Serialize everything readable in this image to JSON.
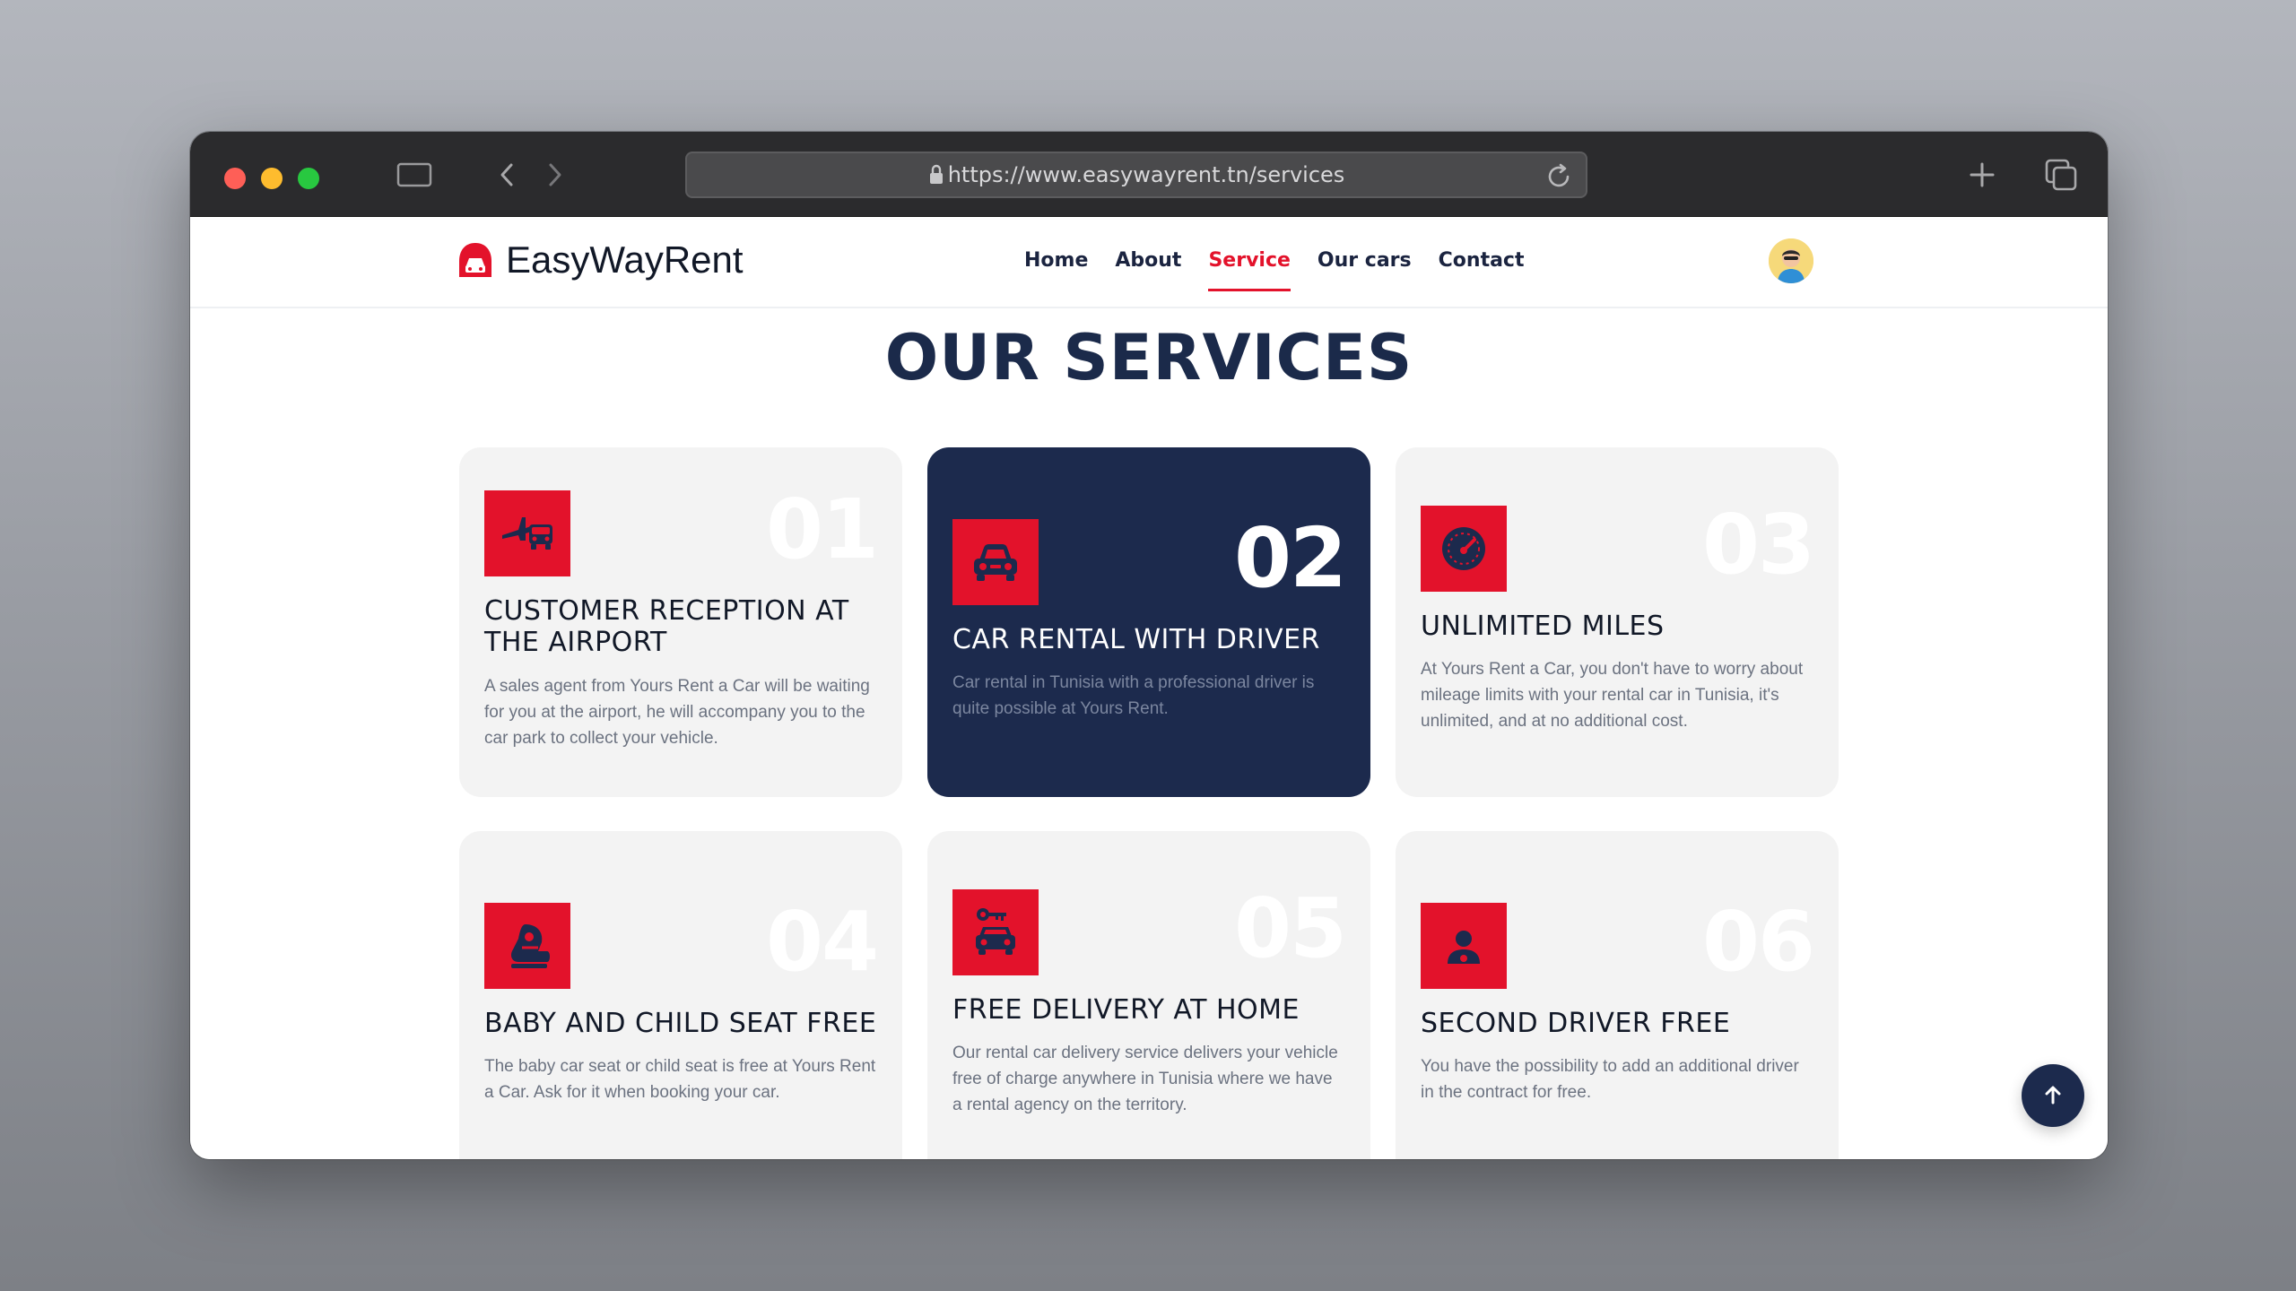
{
  "browser": {
    "url": "https://www.easywayrent.tn/services"
  },
  "site": {
    "brand": "EasyWayRent",
    "nav": [
      {
        "label": "Home"
      },
      {
        "label": "About"
      },
      {
        "label": "Service"
      },
      {
        "label": "Our cars"
      },
      {
        "label": "Contact"
      }
    ],
    "active_nav": "Service"
  },
  "services": {
    "heading": "OUR SERVICES",
    "items": [
      {
        "number": "01",
        "title": "CUSTOMER RECEPTION AT THE AIRPORT",
        "description": "A sales agent from Yours Rent a Car will be waiting for you at the airport, he will accompany you to the car park to collect your vehicle.",
        "icon": "airport-car-icon"
      },
      {
        "number": "02",
        "title": "CAR RENTAL WITH DRIVER",
        "description": "Car rental in Tunisia with a professional driver is quite possible at Yours Rent.",
        "icon": "car-front-icon"
      },
      {
        "number": "03",
        "title": "UNLIMITED MILES",
        "description": "At Yours Rent a Car, you don't have to worry about mileage limits with your rental car in Tunisia, it's unlimited, and at no additional cost.",
        "icon": "speedometer-icon"
      },
      {
        "number": "04",
        "title": "BABY AND CHILD SEAT FREE",
        "description": "The baby car seat or child seat is free at Yours Rent a Car. Ask for it when booking your car.",
        "icon": "baby-seat-icon"
      },
      {
        "number": "05",
        "title": "FREE DELIVERY AT HOME",
        "description": "Our rental car delivery service delivers your vehicle free of charge anywhere in Tunisia where we have a rental agency on the territory.",
        "icon": "car-key-icon"
      },
      {
        "number": "06",
        "title": "SECOND DRIVER FREE",
        "description": "You have the possibility to add an additional driver in the contract for free.",
        "icon": "driver-icon"
      }
    ]
  },
  "colors": {
    "accent_red": "#e3122b",
    "navy": "#1c2a4d",
    "card_bg": "#f3f3f3"
  }
}
